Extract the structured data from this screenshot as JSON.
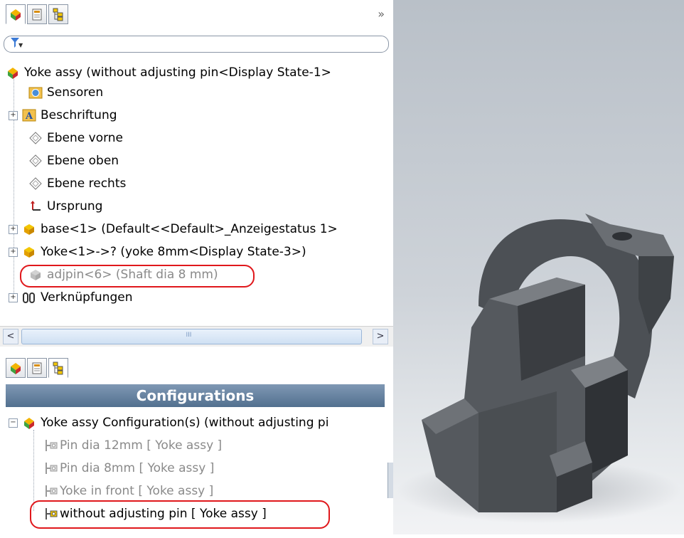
{
  "feature_tabs": [
    {
      "name": "FeatureManager"
    },
    {
      "name": "PropertyManager"
    },
    {
      "name": "ConfigurationManager"
    }
  ],
  "overflow_glyph": "»",
  "filter_glyph": "▼",
  "tree": {
    "root": "Yoke assy  (without adjusting pin<Display State-1>",
    "items": [
      {
        "label": "Sensoren"
      },
      {
        "label": "Beschriftung"
      },
      {
        "label": "Ebene vorne"
      },
      {
        "label": "Ebene oben"
      },
      {
        "label": "Ebene rechts"
      },
      {
        "label": "Ursprung"
      },
      {
        "label": "base<1> (Default<<Default>_Anzeigestatus 1>"
      },
      {
        "label": "Yoke<1>->? (yoke 8mm<Display State-3>)"
      },
      {
        "label": "adjpin<6> (Shaft dia 8 mm)"
      },
      {
        "label": "Verknüpfungen"
      }
    ]
  },
  "scrollbar": {
    "left_arrow": "<",
    "right_arrow": ">",
    "grip": "III"
  },
  "config": {
    "header": "Configurations",
    "root": "Yoke assy Configuration(s)  (without adjusting pi",
    "items": [
      {
        "label": "Pin dia 12mm [ Yoke assy ]"
      },
      {
        "label": "Pin dia 8mm [ Yoke assy ]"
      },
      {
        "label": "Yoke in front [ Yoke assy ]"
      },
      {
        "label": "without adjusting pin [ Yoke assy ]"
      }
    ]
  },
  "colors": {
    "accent_red": "#e0181c",
    "header_blue": "#5b7896",
    "model_gray": "#55595e"
  }
}
